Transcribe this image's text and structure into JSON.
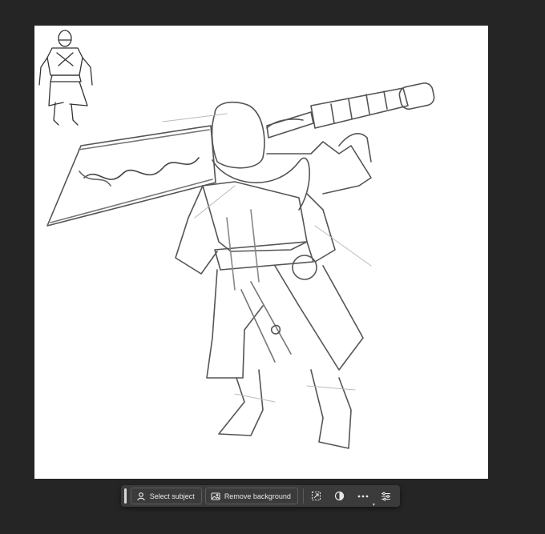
{
  "contextual_taskbar": {
    "select_subject_label": "Select subject",
    "remove_background_label": "Remove background",
    "icons": {
      "select_subject": "person-select-icon",
      "remove_background": "image-icon",
      "transform": "transform-icon",
      "adjustment": "half-circle-icon",
      "more": "more-dots-icon",
      "settings": "sliders-icon"
    }
  },
  "colors": {
    "workspace_bg": "#252525",
    "canvas_bg": "#ffffff",
    "taskbar_bg": "#3b3b3b",
    "sketch_stroke": "#4a4a4a"
  }
}
